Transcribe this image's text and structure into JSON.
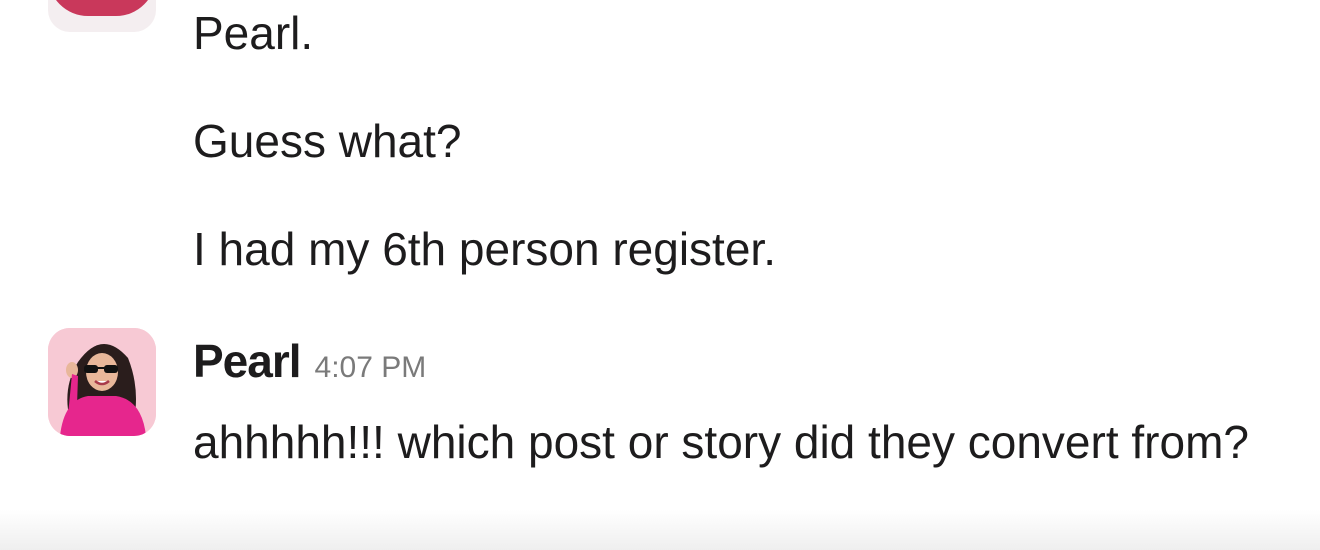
{
  "messages_previous": [
    "Pearl.",
    "Guess what?",
    "I had my 6th person register."
  ],
  "reply": {
    "sender": "Pearl",
    "time": "4:07 PM",
    "text": "ahhhhh!!! which post or story did they convert from?"
  }
}
